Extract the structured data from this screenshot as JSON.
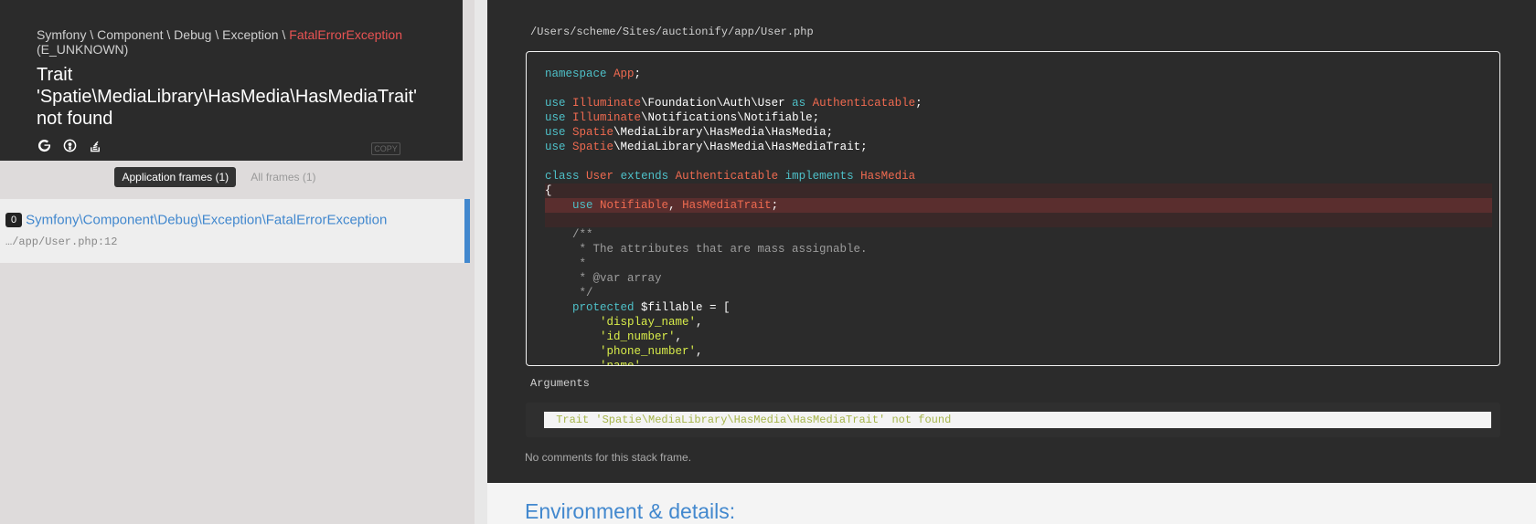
{
  "exception": {
    "namespace_text": "Symfony \\ Component \\ Debug \\ Exception \\ ",
    "class_name": "FatalErrorException",
    "code": "(E_UNKNOWN)",
    "message_line1": "Trait",
    "message_line2": "'Spatie\\MediaLibrary\\HasMedia\\HasMediaTrait'",
    "message_line3": "not found",
    "copy_label": "COPY"
  },
  "icons": [
    "google-icon",
    "duckduckgo-icon",
    "stackoverflow-icon"
  ],
  "frames_tabs": {
    "application": "Application frames (1)",
    "all": "All frames (1)"
  },
  "frames": [
    {
      "index": "0",
      "class": "Symfony\\Component\\Debug\\Exception\\FatalErrorException",
      "file": "…/app/User.php:12"
    }
  ],
  "code_panel": {
    "file_path": "/Users/scheme/Sites/auctionify/app/User.php",
    "arguments_label": "Arguments",
    "argument_value": " Trait 'Spatie\\MediaLibrary\\HasMedia\\HasMediaTrait' not found",
    "no_comments": "No comments for this stack frame."
  },
  "environment_title": "Environment & details:",
  "colors": {
    "accent_blue": "#4288ce",
    "error_red": "#e95353",
    "keyword": "#4ec0c8",
    "classname": "#ef6a50",
    "string": "#d8ec4a"
  }
}
